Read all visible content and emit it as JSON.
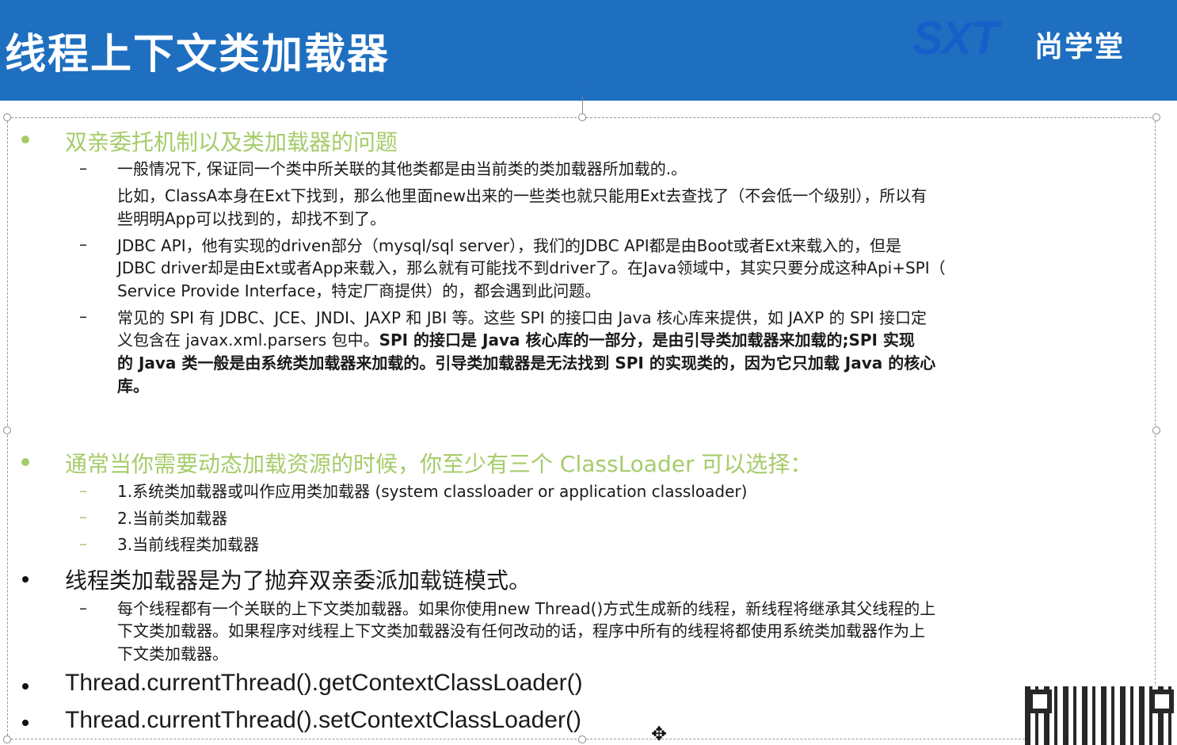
{
  "header": {
    "title": "线程上下文类加载器",
    "logo_mark": "SXT",
    "logo_text": "尚学堂",
    "background_color": "#1f6fc0"
  },
  "section1": {
    "heading": "双亲委托机制以及类加载器的问题",
    "item1_line1": "一般情况下, 保证同一个类中所关联的其他类都是由当前类的类加载器所加载的.。",
    "item1_line2": "比如，ClassA本身在Ext下找到，那么他里面new出来的一些类也就只能用Ext去查找了（不会低一个级别），所以有",
    "item1_line3": "些明明App可以找到的，却找不到了。",
    "item2_line1": "JDBC API，他有实现的driven部分（mysql/sql server），我们的JDBC API都是由Boot或者Ext来载入的，但是",
    "item2_line2": "JDBC driver却是由Ext或者App来载入，那么就有可能找不到driver了。在Java领域中，其实只要分成这种Api+SPI（",
    "item2_line3": "Service Provide Interface，特定厂商提供）的，都会遇到此问题。",
    "item3_line1": "常见的 SPI 有 JDBC、JCE、JNDI、JAXP 和 JBI 等。这些 SPI 的接口由 Java 核心库来提供，如 JAXP 的 SPI 接口定",
    "item3_line2_normal": "义包含在 javax.xml.parsers 包中。",
    "item3_line2_bold": "SPI 的接口是 Java 核心库的一部分，是由引导类加载器来加载的;SPI 实现",
    "item3_line3": "的 Java 类一般是由系统类加载器来加载的。引导类加载器是无法找到 SPI 的实现类的，因为它只加载 Java 的核心",
    "item3_line4": "库。"
  },
  "section2": {
    "heading": "通常当你需要动态加载资源的时候，你至少有三个 ClassLoader 可以选择：",
    "items": [
      "1.系统类加载器或叫作应用类加载器 (system classloader or application classloader)",
      "2.当前类加载器",
      "3.当前线程类加载器"
    ]
  },
  "section3": {
    "heading": "线程类加载器是为了抛弃双亲委派加载链模式。",
    "item_line1": "每个线程都有一个关联的上下文类加载器。如果你使用new Thread()方式生成新的线程，新线程将继承其父线程的上",
    "item_line2": "下文类加载器。如果程序对线程上下文类加载器没有任何改动的话，程序中所有的线程将都使用系统类加载器作为上",
    "item_line3": "下文类加载器。"
  },
  "code_lines": [
    "Thread.currentThread().getContextClassLoader()",
    "Thread.currentThread().setContextClassLoader()"
  ],
  "colors": {
    "accent_green": "#a6cc6a",
    "text_dark": "#1a1a1a"
  },
  "icons": [
    "rotate-handle-icon",
    "move-cursor-icon",
    "qr-code"
  ]
}
